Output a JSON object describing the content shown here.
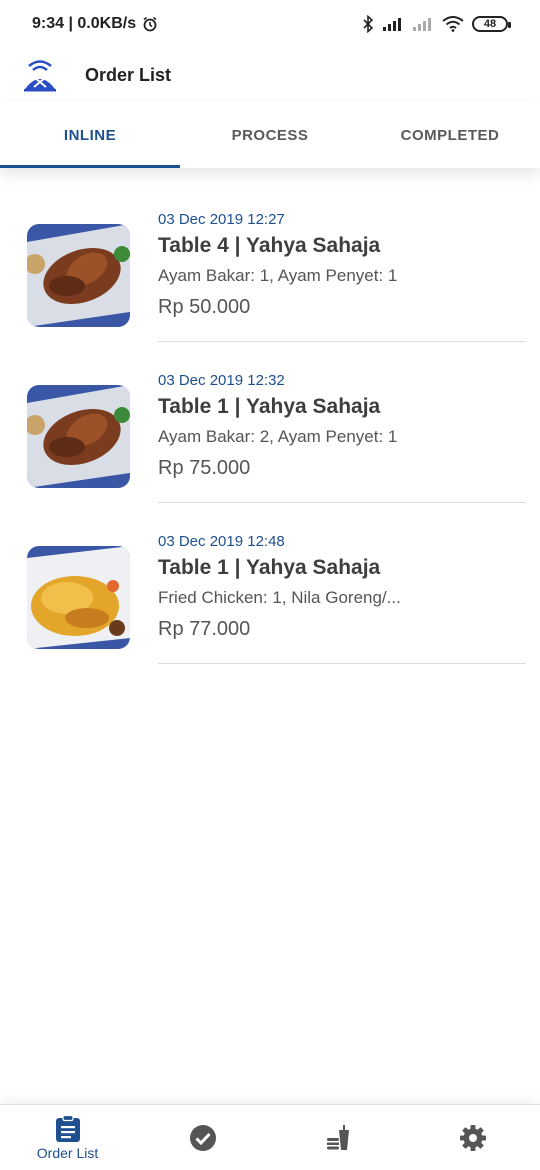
{
  "status_bar": {
    "time_speed": "9:34 | 0.0KB/s",
    "battery": "48"
  },
  "app_bar": {
    "title": "Order List"
  },
  "tabs": [
    {
      "label": "INLINE",
      "active": true
    },
    {
      "label": "PROCESS",
      "active": false
    },
    {
      "label": "COMPLETED",
      "active": false
    }
  ],
  "orders": [
    {
      "date": "03 Dec 2019 12:27",
      "table": "Table 4 | Yahya Sahaja",
      "items": "Ayam Bakar: 1, Ayam Penyet: 1",
      "total": "Rp 50.000",
      "image": "grilled-chicken"
    },
    {
      "date": "03 Dec 2019 12:32",
      "table": "Table 1 | Yahya Sahaja",
      "items": "Ayam Bakar: 2, Ayam Penyet: 1",
      "total": "Rp 75.000",
      "image": "grilled-chicken"
    },
    {
      "date": "03 Dec 2019 12:48",
      "table": "Table 1 | Yahya Sahaja",
      "items": "Fried Chicken: 1, Nila Goreng/...",
      "total": "Rp 77.000",
      "image": "fried-chicken"
    }
  ],
  "bottom_nav": {
    "order_list_label": "Order List",
    "items": [
      "order-list-icon",
      "check-circle-icon",
      "food-menu-icon",
      "settings-gear-icon"
    ]
  },
  "colors": {
    "accent": "#1e4f8f"
  }
}
